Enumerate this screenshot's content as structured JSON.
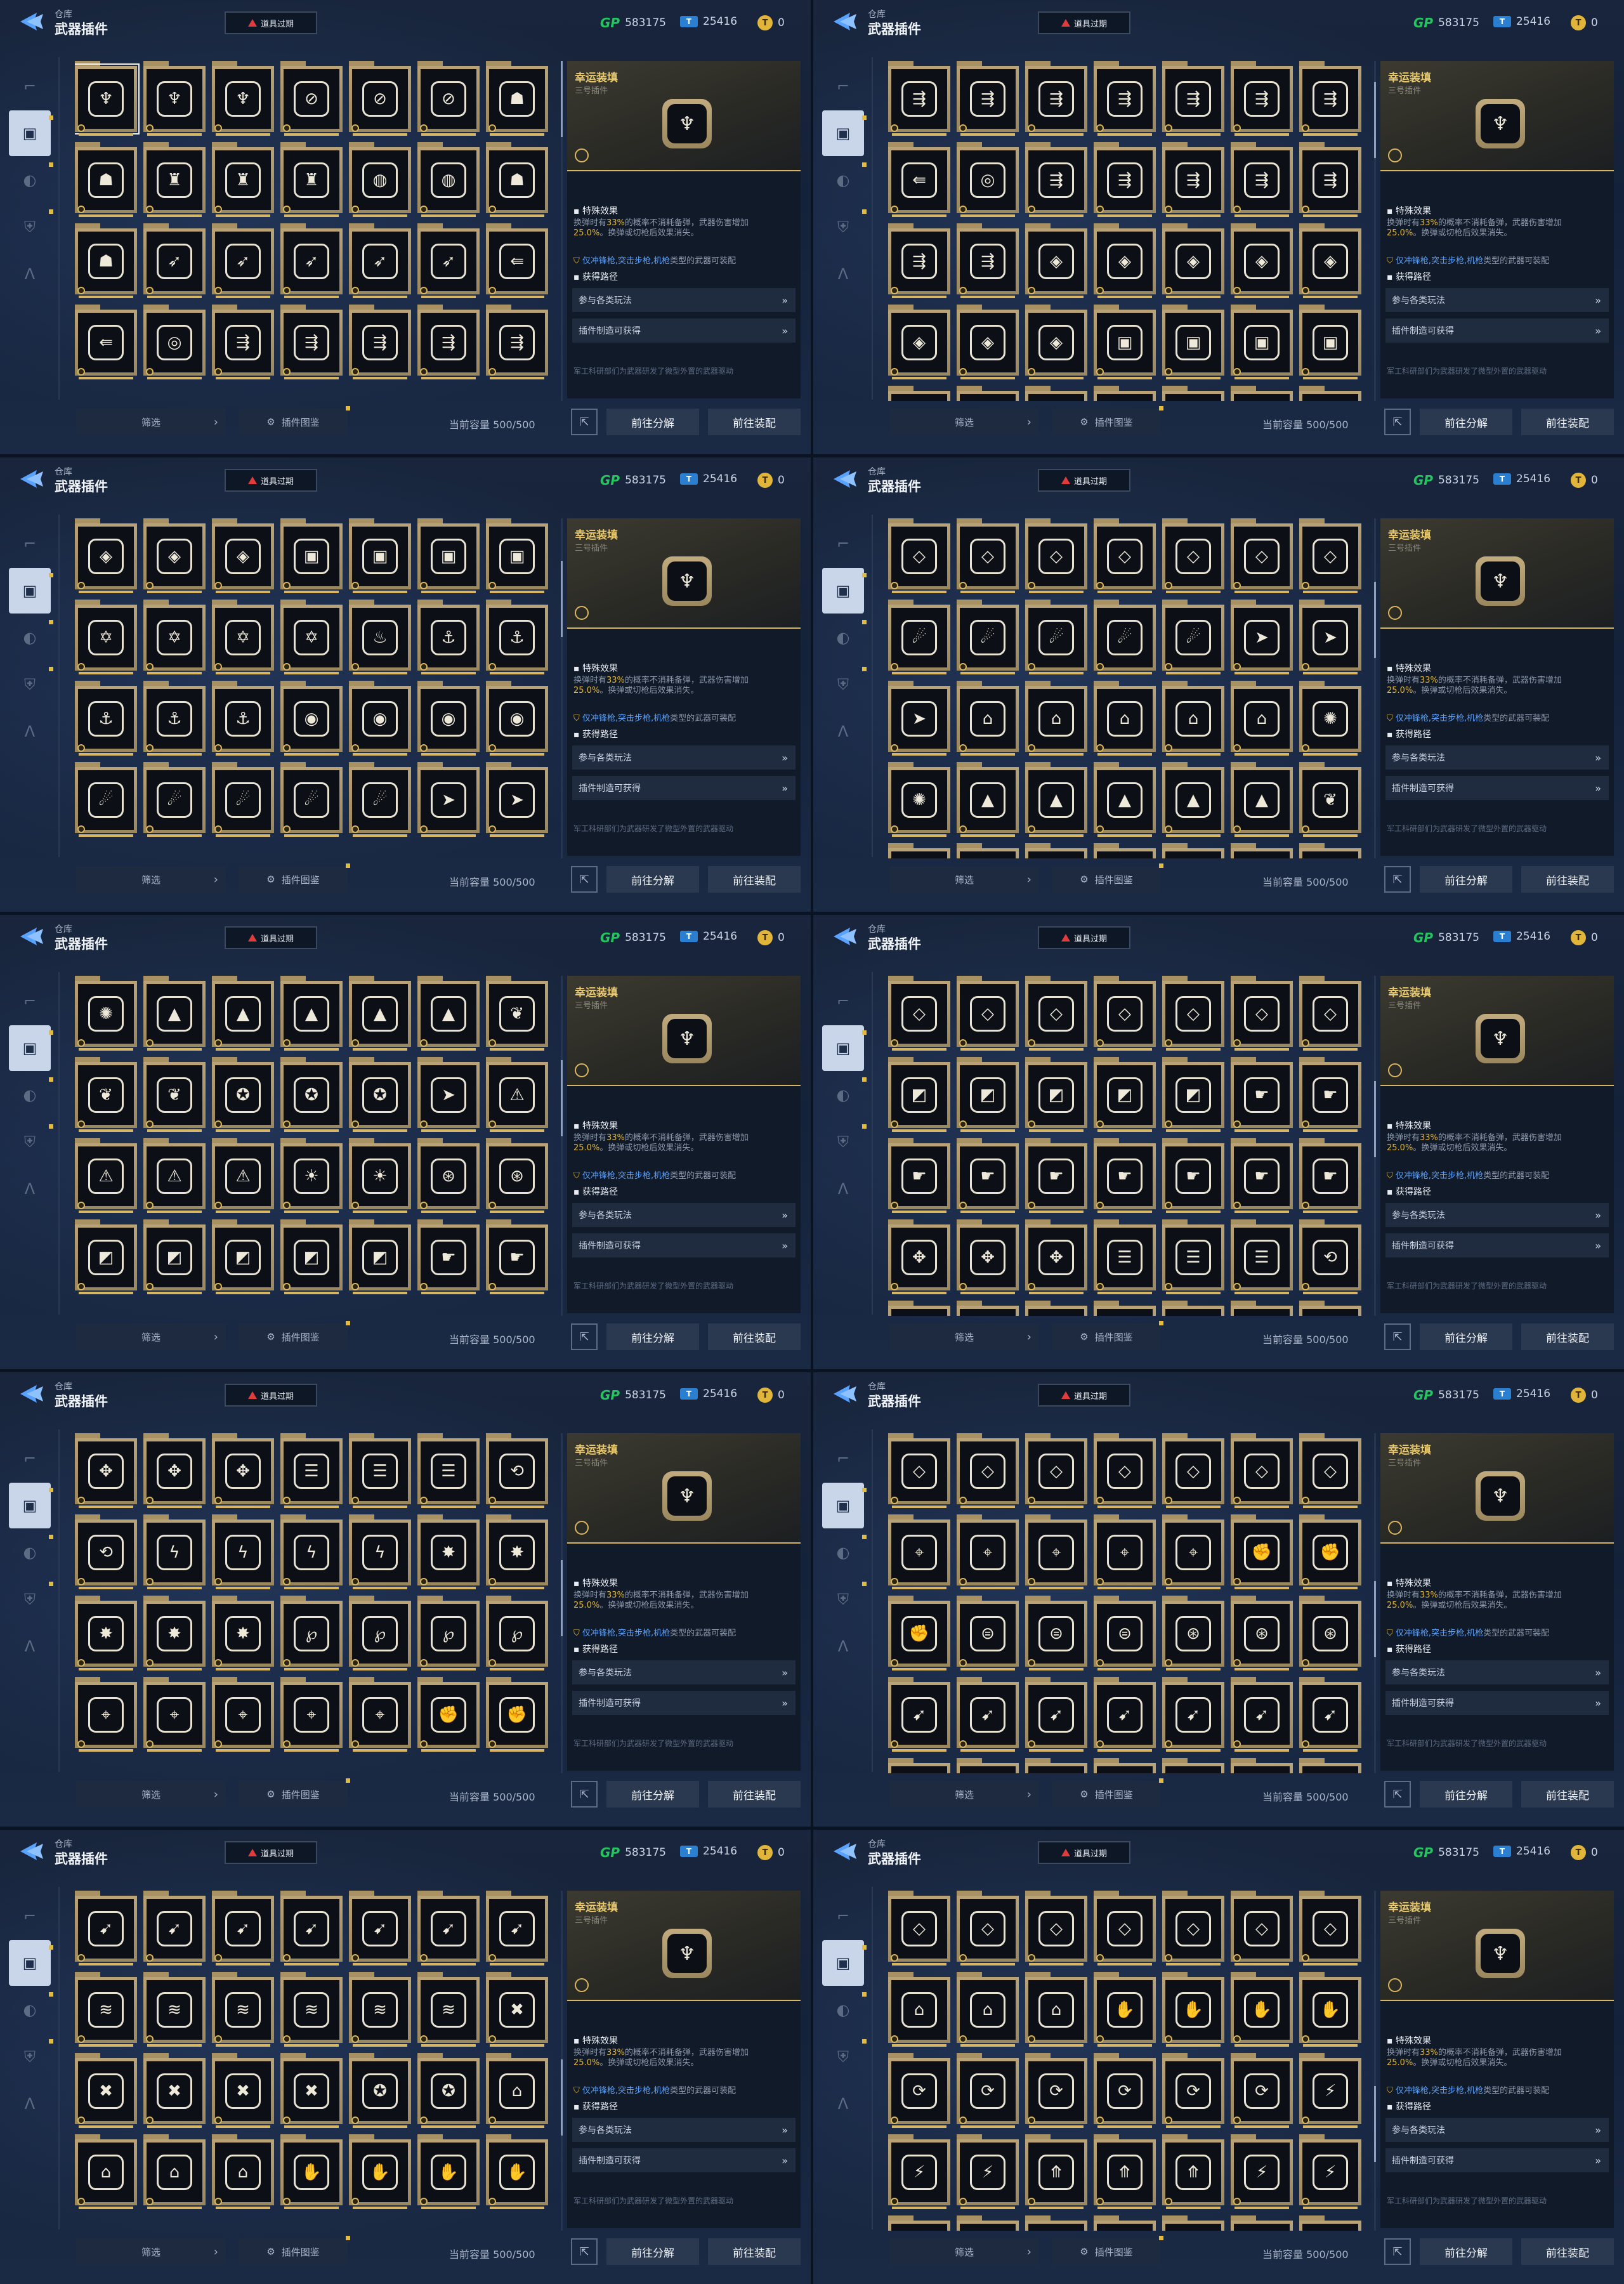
{
  "header": {
    "breadcrumb": "仓库",
    "title": "武器插件",
    "expire_button": "道具过期",
    "gp_label": "GP",
    "gp_value": "583175",
    "ticket_value": "25416",
    "coin_value": "0"
  },
  "sidebar": {
    "items": [
      {
        "icon": "pistol-icon"
      },
      {
        "icon": "plugin-chip-icon"
      },
      {
        "icon": "grenade-icon"
      },
      {
        "icon": "armor-icon"
      },
      {
        "icon": "badge-a-icon"
      }
    ]
  },
  "detail": {
    "name": "幸运装填",
    "subtitle": "三号插件",
    "effect_heading": "特殊效果",
    "effect_text_pre": "换弹时有",
    "effect_pct": "33%",
    "effect_text_mid": "的概率不消耗备弹，武器伤害增加",
    "effect_value": "25.0%",
    "effect_text_post": "。换弹或切枪后效果消失。",
    "restriction_pre": "仅",
    "restriction_weapons": "冲锋枪,突击步枪,机枪",
    "restriction_post": "类型的武器可装配",
    "source_heading": "获得路径",
    "source_1": "参与各类玩法",
    "source_2": "插件制造可获得",
    "flavor": "军工科研部们为武器研发了微型外置的武器驱动"
  },
  "footer": {
    "filter": "筛选",
    "atlas": "插件图鉴",
    "capacity": "当前容量 500/500",
    "decompose": "前往分解",
    "equip": "前往装配"
  },
  "panels": [
    {
      "rows": [
        [
          "♆",
          "♆",
          "♆",
          "⊘",
          "⊘",
          "⊘",
          "☗"
        ],
        [
          "☗",
          "♜",
          "♜",
          "♜",
          "◍",
          "◍",
          "☗"
        ],
        [
          "☗",
          "➶",
          "➶",
          "➶",
          "➶",
          "➶",
          "⇚"
        ],
        [
          "⇚",
          "◎",
          "⇶",
          "⇶",
          "⇶",
          "⇶",
          "⇶"
        ]
      ],
      "scroll": 0.0
    },
    {
      "rows": [
        [
          "⇶",
          "⇶",
          "⇶",
          "⇶",
          "⇶",
          "⇶",
          "⇶"
        ],
        [
          "⇚",
          "◎",
          "⇶",
          "⇶",
          "⇶",
          "⇶",
          "⇶"
        ],
        [
          "⇶",
          "⇶",
          "◈",
          "◈",
          "◈",
          "◈",
          "◈"
        ],
        [
          "◈",
          "◈",
          "◈",
          "▣",
          "▣",
          "▣",
          "▣"
        ],
        [
          "✡",
          "✡",
          "✡",
          "✡",
          "♨",
          "⚓",
          "⚓"
        ]
      ],
      "scroll": 0.08
    },
    {
      "rows": [
        [
          "◈",
          "◈",
          "◈",
          "▣",
          "▣",
          "▣",
          "▣"
        ],
        [
          "✡",
          "✡",
          "✡",
          "✡",
          "♨",
          "⚓",
          "⚓"
        ],
        [
          "⚓",
          "⚓",
          "⚓",
          "◉",
          "◉",
          "◉",
          "◉"
        ],
        [
          "☄",
          "☄",
          "☄",
          "☄",
          "☄",
          "➤",
          "➤"
        ]
      ],
      "scroll": 0.16
    },
    {
      "rows": [
        [
          "◇",
          "◇",
          "◇",
          "◇",
          "◇",
          "◇",
          "◇"
        ],
        [
          "☄",
          "☄",
          "☄",
          "☄",
          "☄",
          "➤",
          "➤"
        ],
        [
          "➤",
          "⌂",
          "⌂",
          "⌂",
          "⌂",
          "⌂",
          "✺"
        ],
        [
          "✺",
          "▲",
          "▲",
          "▲",
          "▲",
          "▲",
          "❦"
        ],
        [
          "❦",
          "❦",
          "❦",
          "✪",
          "✪",
          "➤",
          "⚠"
        ]
      ],
      "scroll": 0.24
    },
    {
      "rows": [
        [
          "✺",
          "▲",
          "▲",
          "▲",
          "▲",
          "▲",
          "❦"
        ],
        [
          "❦",
          "❦",
          "✪",
          "✪",
          "✪",
          "➤",
          "⚠"
        ],
        [
          "⚠",
          "⚠",
          "⚠",
          "☀",
          "☀",
          "⊛",
          "⊛"
        ],
        [
          "◩",
          "◩",
          "◩",
          "◩",
          "◩",
          "☛",
          "☛"
        ]
      ],
      "scroll": 0.32
    },
    {
      "rows": [
        [
          "◇",
          "◇",
          "◇",
          "◇",
          "◇",
          "◇",
          "◇"
        ],
        [
          "◩",
          "◩",
          "◩",
          "◩",
          "◩",
          "☛",
          "☛"
        ],
        [
          "☛",
          "☛",
          "☛",
          "☛",
          "☛",
          "☛",
          "☛"
        ],
        [
          "✥",
          "✥",
          "✥",
          "☰",
          "☰",
          "☰",
          "⟲"
        ],
        [
          "⟲",
          "ϟ",
          "ϟ",
          "ϟ",
          "ϟ",
          "✸",
          "✸"
        ]
      ],
      "scroll": 0.4
    },
    {
      "rows": [
        [
          "✥",
          "✥",
          "✥",
          "☰",
          "☰",
          "☰",
          "⟲"
        ],
        [
          "⟲",
          "ϟ",
          "ϟ",
          "ϟ",
          "ϟ",
          "✸",
          "✸"
        ],
        [
          "✸",
          "✸",
          "✸",
          "℘",
          "℘",
          "℘",
          "℘"
        ],
        [
          "⌖",
          "⌖",
          "⌖",
          "⌖",
          "⌖",
          "✊",
          "✊"
        ]
      ],
      "scroll": 0.48
    },
    {
      "rows": [
        [
          "◇",
          "◇",
          "◇",
          "◇",
          "◇",
          "◇",
          "◇"
        ],
        [
          "⌖",
          "⌖",
          "⌖",
          "⌖",
          "⌖",
          "✊",
          "✊"
        ],
        [
          "✊",
          "⊜",
          "⊜",
          "⊜",
          "⊛",
          "⊛",
          "⊛"
        ],
        [
          "➹",
          "➹",
          "➹",
          "➹",
          "➹",
          "➹",
          "➹"
        ],
        [
          "≋",
          "≋",
          "≋",
          "≋",
          "≋",
          "≋",
          "✖"
        ]
      ],
      "scroll": 0.56
    },
    {
      "rows": [
        [
          "➹",
          "➹",
          "➹",
          "➹",
          "➹",
          "➹",
          "➹"
        ],
        [
          "≋",
          "≋",
          "≋",
          "≋",
          "≋",
          "≋",
          "✖"
        ],
        [
          "✖",
          "✖",
          "✖",
          "✖",
          "✪",
          "✪",
          "⌂"
        ],
        [
          "⌂",
          "⌂",
          "⌂",
          "✋",
          "✋",
          "✋",
          "✋"
        ]
      ],
      "scroll": 0.64
    },
    {
      "rows": [
        [
          "◇",
          "◇",
          "◇",
          "◇",
          "◇",
          "◇",
          "◇"
        ],
        [
          "⌂",
          "⌂",
          "⌂",
          "✋",
          "✋",
          "✋",
          "✋"
        ],
        [
          "⟳",
          "⟳",
          "⟳",
          "⟳",
          "⟳",
          "⟳",
          "⚡"
        ],
        [
          "⚡",
          "⚡",
          "⤊",
          "⤊",
          "⤊",
          "⚡",
          "⚡"
        ],
        [
          "⤓",
          "⤓",
          "⤓",
          "⤓",
          "⤓",
          "⤓",
          "⤓"
        ]
      ],
      "scroll": 0.74
    }
  ],
  "colors": {
    "accent_gold": "#d7b565",
    "highlight_yellow": "#e0b53a",
    "restriction_blue": "#5aa2ff",
    "warning_red": "#e23b3b",
    "gp_green": "#22c55e",
    "ticket_blue": "#2b7fd1"
  }
}
